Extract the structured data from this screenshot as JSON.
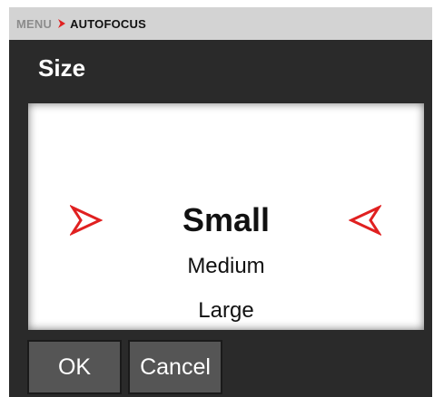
{
  "breadcrumb": {
    "root": "MENU",
    "current": "AUTOFOCUS",
    "separator_icon": "chevron-right-icon",
    "accent_color": "#e02020"
  },
  "page": {
    "title": "Size"
  },
  "picker": {
    "selected": "Small",
    "options": [
      "Small",
      "Medium",
      "Large"
    ],
    "left_arrow_icon": "arrow-right-outline-icon",
    "right_arrow_icon": "arrow-left-outline-icon",
    "arrow_color": "#e02020"
  },
  "buttons": {
    "ok_label": "OK",
    "cancel_label": "Cancel"
  }
}
